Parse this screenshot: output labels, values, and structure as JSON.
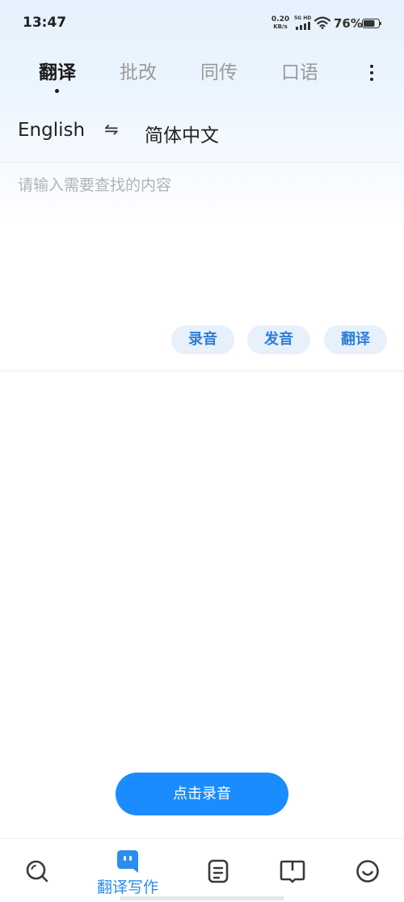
{
  "status_bar": {
    "time": "13:47",
    "net_speed_value": "0.20",
    "net_speed_unit": "KB/s",
    "network_label": "5G HD",
    "battery_percent": "76%",
    "icons": [
      "signal-icon",
      "wifi-icon",
      "battery-icon"
    ]
  },
  "tabs": [
    {
      "label": "翻译",
      "active": true
    },
    {
      "label": "批改",
      "active": false
    },
    {
      "label": "同传",
      "active": false
    },
    {
      "label": "口语",
      "active": false
    }
  ],
  "more_icon": "more-vertical-icon",
  "language": {
    "source": "English",
    "swap_symbol": "⇋",
    "target": "简体中文"
  },
  "input": {
    "value": "",
    "placeholder": "请输入需要查找的内容"
  },
  "actions": {
    "record": "录音",
    "pronounce": "发音",
    "translate": "翻译"
  },
  "record_button": "点击录音",
  "bottom_nav": {
    "items": [
      {
        "icon": "search-icon",
        "label": ""
      },
      {
        "icon": "chat-bubble-icon",
        "label": "翻译写作",
        "active": true
      },
      {
        "icon": "document-icon",
        "label": ""
      },
      {
        "icon": "book-icon",
        "label": ""
      },
      {
        "icon": "smile-icon",
        "label": ""
      }
    ]
  },
  "colors": {
    "accent": "#1a8cff",
    "pill_bg": "#e7f0fb",
    "pill_text": "#2e7fd6",
    "active_nav": "#2a8df0",
    "inactive_icon": "#3a3a3a"
  }
}
